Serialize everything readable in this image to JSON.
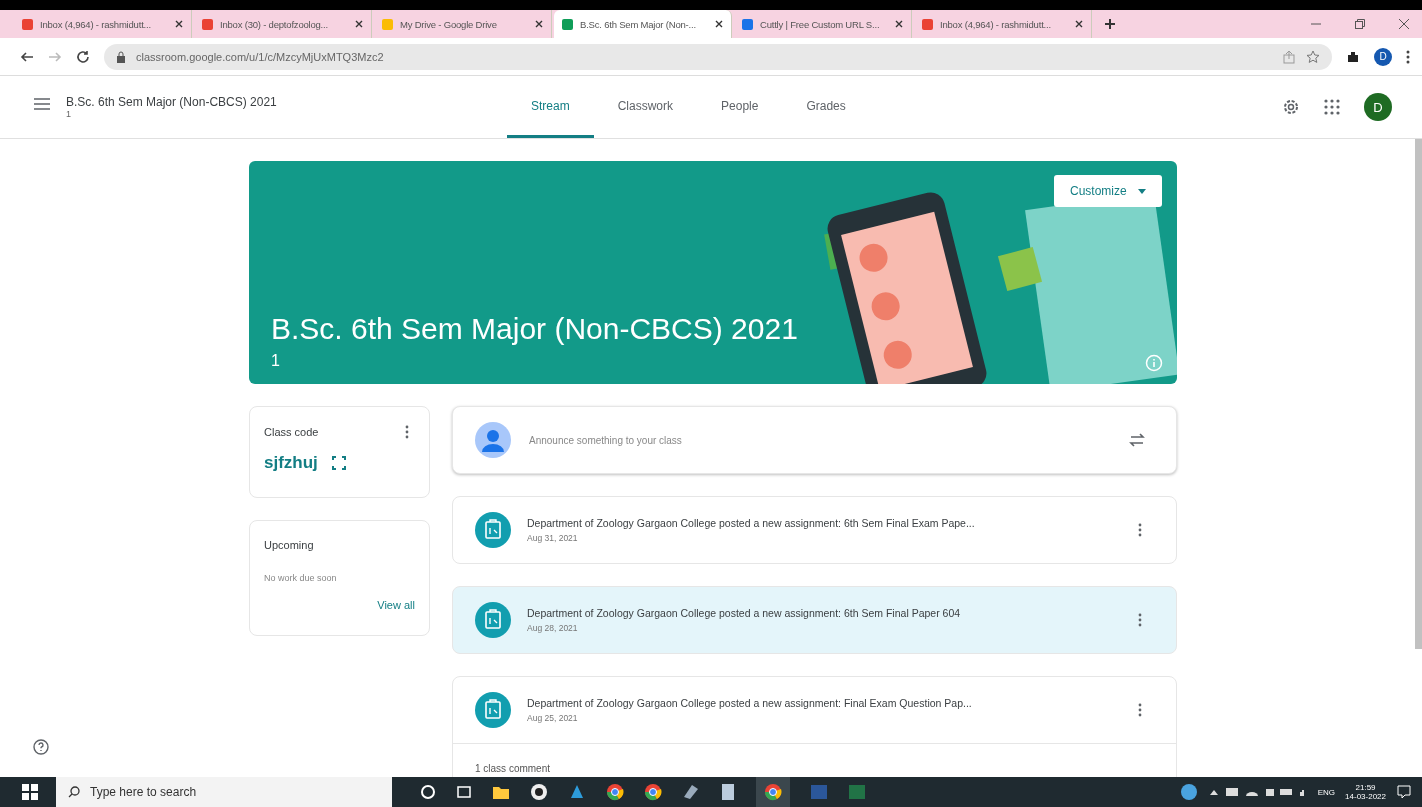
{
  "browser": {
    "tabs": [
      {
        "title": "Inbox (4,964) - rashmidutt...",
        "kind": "mail",
        "selected": false
      },
      {
        "title": "Inbox (30) - deptofzoolog...",
        "kind": "mail",
        "selected": false
      },
      {
        "title": "My Drive - Google Drive",
        "kind": "drive",
        "selected": false
      },
      {
        "title": "B.Sc. 6th Sem Major (Non-...",
        "kind": "classroom",
        "selected": true
      },
      {
        "title": "Cuttly | Free Custom URL S...",
        "kind": "cuttly",
        "selected": false
      },
      {
        "title": "Inbox (4,964) - rashmidutt...",
        "kind": "mail",
        "selected": false
      }
    ],
    "url": "classroom.google.com/u/1/c/MzcyMjUxMTQ3Mzc2",
    "profile_initial": "D"
  },
  "header": {
    "class_name": "B.Sc. 6th Sem Major (Non-CBCS) 2021",
    "section": "1",
    "tabs": [
      {
        "label": "Stream",
        "selected": true
      },
      {
        "label": "Classwork",
        "selected": false
      },
      {
        "label": "People",
        "selected": false
      },
      {
        "label": "Grades",
        "selected": false
      }
    ],
    "avatar_initial": "D"
  },
  "banner": {
    "title": "B.Sc. 6th Sem Major (Non-CBCS) 2021",
    "section": "1",
    "customize_label": "Customize"
  },
  "class_code": {
    "label": "Class code",
    "code": "sjfzhuj"
  },
  "upcoming": {
    "title": "Upcoming",
    "empty_text": "No work due soon",
    "link": "View all"
  },
  "announce": {
    "placeholder": "Announce something to your class"
  },
  "posts": [
    {
      "text": "Department of Zoology Gargaon College posted a new assignment: 6th Sem Final Exam Pape...",
      "date": "Aug 31, 2021",
      "selected": false
    },
    {
      "text": "Department of Zoology Gargaon College posted a new assignment: 6th Sem Final Paper 604",
      "date": "Aug 28, 2021",
      "selected": true
    },
    {
      "text": "Department of Zoology Gargaon College posted a new assignment: Final Exam Question Pap...",
      "date": "Aug 25, 2021",
      "selected": false,
      "comments": "1 class comment"
    }
  ],
  "taskbar": {
    "search_placeholder": "Type here to search",
    "language": "ENG",
    "time": "21:59",
    "date": "14-03-2022"
  }
}
